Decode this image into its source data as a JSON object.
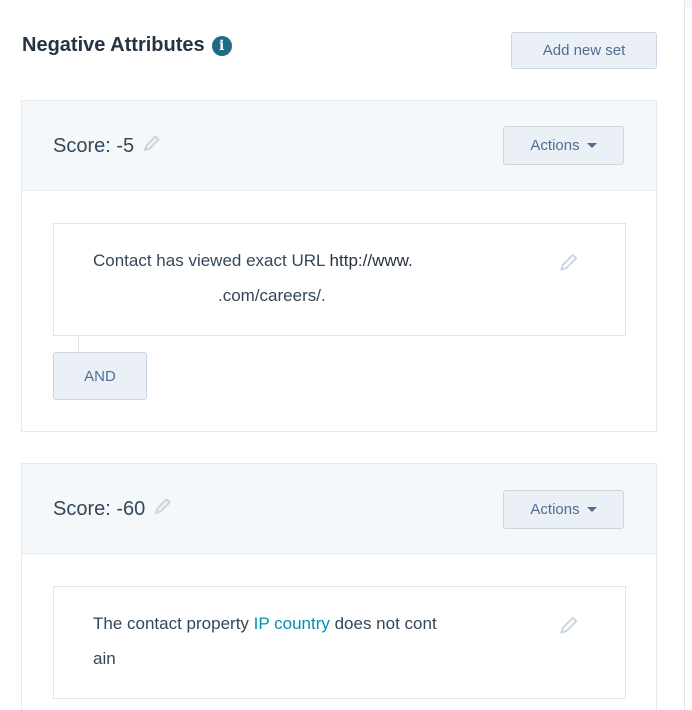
{
  "header": {
    "title": "Negative Attributes",
    "add_set_label": "Add new set"
  },
  "sets": [
    {
      "score_label": "Score: -5",
      "actions_label": "Actions",
      "rule": {
        "line1_prefix": "Contact has viewed exact URL ",
        "line1_url": "http://www.",
        "line2": ".com/careers/."
      },
      "and_label": "AND"
    },
    {
      "score_label": "Score: -60",
      "actions_label": "Actions",
      "rule": {
        "line1_prefix": "The contact property ",
        "line1_link": "IP country",
        "line1_suffix": " does not cont",
        "line2": "ain"
      }
    }
  ],
  "colors": {
    "accent": "#0091ae",
    "header_bg": "#f5f8fa",
    "button_bg": "#eaf0f6",
    "text": "#33475b"
  },
  "icons": [
    "info-icon",
    "pencil-icon",
    "caret-down-icon"
  ]
}
